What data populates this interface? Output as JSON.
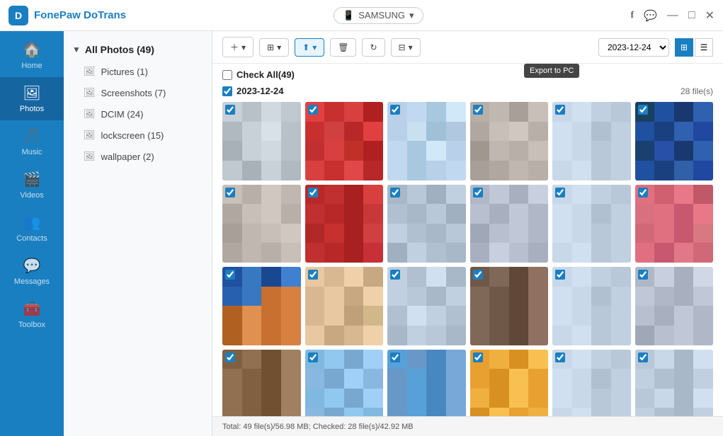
{
  "app": {
    "name": "FonePaw DoTrans",
    "logo_letter": "D"
  },
  "title_bar": {
    "device_name": "SAMSUNG",
    "device_icon": "📱",
    "dropdown_arrow": "▾",
    "fb_icon": "f",
    "chat_icon": "💬",
    "minimize": "—",
    "maximize": "□",
    "close": "✕"
  },
  "nav": {
    "items": [
      {
        "id": "home",
        "label": "Home",
        "icon": "🏠",
        "active": false
      },
      {
        "id": "photos",
        "label": "Photos",
        "icon": "👤",
        "active": true
      },
      {
        "id": "music",
        "label": "Music",
        "icon": "🎵",
        "active": false
      },
      {
        "id": "videos",
        "label": "Videos",
        "icon": "🎬",
        "active": false
      },
      {
        "id": "contacts",
        "label": "Contacts",
        "icon": "👥",
        "active": false
      },
      {
        "id": "messages",
        "label": "Messages",
        "icon": "💬",
        "active": false
      },
      {
        "id": "toolbox",
        "label": "Toolbox",
        "icon": "🧰",
        "active": false
      }
    ]
  },
  "tree": {
    "root_label": "All Photos (49)",
    "items": [
      {
        "label": "Pictures (1)",
        "count": 1
      },
      {
        "label": "Screenshots (7)",
        "count": 7
      },
      {
        "label": "DCIM (24)",
        "count": 24
      },
      {
        "label": "lockscreen (15)",
        "count": 15
      },
      {
        "label": "wallpaper (2)",
        "count": 2
      }
    ]
  },
  "toolbar": {
    "add_label": "+",
    "copy_label": "⊞",
    "export_label": "⬆",
    "export_tooltip": "Export to PC",
    "delete_label": "🗑",
    "refresh_label": "↻",
    "more_label": "⊟",
    "date_value": "2023-12-24",
    "grid_view_label": "⊞",
    "list_view_label": "☰"
  },
  "content": {
    "check_all_label": "Check All(49)",
    "date_section": "2023-12-24",
    "file_count": "28 file(s)",
    "rows": [
      {
        "photos": [
          {
            "colors": [
              "#c8d0d8",
              "#b8c0c8",
              "#d0d8e0",
              "#c0c8d0",
              "#b0b8c0",
              "#c8d0d8",
              "#d8e0e8",
              "#b8c0c8",
              "#a8b0b8",
              "#c8d0d8",
              "#d0d8e0",
              "#b8c0c8",
              "#c0c8d0",
              "#a8b0b8",
              "#c8d0d8",
              "#b0b8c0"
            ]
          },
          {
            "colors": [
              "#e04040",
              "#c83030",
              "#d84040",
              "#b02020",
              "#c83030",
              "#d04040",
              "#b82828",
              "#e04040",
              "#c03030",
              "#d84040",
              "#c03028",
              "#b02020",
              "#d84040",
              "#c83030",
              "#e04848",
              "#b82828"
            ]
          },
          {
            "colors": [
              "#b8d0e8",
              "#c0d8f0",
              "#a8c8e0",
              "#d0e8f8",
              "#b8d0e8",
              "#c8e0f0",
              "#a0c0d8",
              "#b0c8e0",
              "#c0d8f0",
              "#a8c8e0",
              "#d0e8f8",
              "#b8d0e8",
              "#c0d8f0",
              "#a8c8e0",
              "#b8d0e8",
              "#c0d8f0"
            ]
          },
          {
            "colors": [
              "#b8b0a8",
              "#c0b8b0",
              "#a8a098",
              "#c8c0b8",
              "#b0a8a0",
              "#c8c0b8",
              "#d0c8c0",
              "#b8b0a8",
              "#a0988e",
              "#c0b8b0",
              "#b8b0a8",
              "#c8c0b8",
              "#a8a098",
              "#b0a8a0",
              "#c0b8b0",
              "#b8b0a8"
            ]
          },
          {
            "colors": [
              "#c8d8e8",
              "#d0e0f0",
              "#c0d0e0",
              "#b8c8d8",
              "#d0e0f0",
              "#c8d8e8",
              "#b0c0d0",
              "#c0d0e0",
              "#d0e0f0",
              "#c8d8e8",
              "#b8c8d8",
              "#c0d0e0",
              "#c8d8e8",
              "#d0e0f0",
              "#b8c8d8",
              "#c0d0e0"
            ]
          },
          {
            "colors": [
              "#1a4060",
              "#2050a0",
              "#1a3870",
              "#3060b0",
              "#2050a0",
              "#1a4080",
              "#3060b0",
              "#2048a0",
              "#1a4070",
              "#2850a8",
              "#1a3870",
              "#3060b0",
              "#2050a0",
              "#1a4080",
              "#3060a8",
              "#2048a0"
            ]
          }
        ]
      },
      {
        "photos": [
          {
            "colors": [
              "#c8c0b8",
              "#b8b0a8",
              "#d0c8c0",
              "#c0b8b0",
              "#b0a8a0",
              "#c8c0b8",
              "#d0c8c0",
              "#b8b0a8",
              "#a8a098",
              "#c0b8b0",
              "#c8c0b8",
              "#d0c8c0",
              "#b0a8a0",
              "#c0b8b0",
              "#b8b0a8",
              "#c8c0b8"
            ]
          },
          {
            "colors": [
              "#b82828",
              "#c03030",
              "#a82020",
              "#d84040",
              "#c03030",
              "#b82828",
              "#a82020",
              "#c83838",
              "#b02828",
              "#c83030",
              "#a82020",
              "#d04040",
              "#c03030",
              "#b82828",
              "#a82020",
              "#c83038"
            ]
          },
          {
            "colors": [
              "#a8b8c8",
              "#b8c8d8",
              "#a0b0c0",
              "#c0d0e0",
              "#b0c0d0",
              "#a8b8c8",
              "#b8c8d8",
              "#a0b0c0",
              "#c0d0e0",
              "#b0c0d0",
              "#a8b8c8",
              "#b8c8d8",
              "#a0b0c0",
              "#c0d0e0",
              "#b0c0d0",
              "#a8b8c8"
            ]
          },
          {
            "colors": [
              "#b0b8c8",
              "#c0c8d8",
              "#a8b0c0",
              "#c8d0e0",
              "#b8c0d0",
              "#a8b0c0",
              "#c0c8d8",
              "#b0b8c8",
              "#a0a8b8",
              "#b8c0d0",
              "#c0c8d8",
              "#b0b8c8",
              "#a8b0c0",
              "#c8d0e0",
              "#b8c0d0",
              "#a8b0c0"
            ]
          },
          {
            "colors": [
              "#c8d8e8",
              "#d0e0f0",
              "#c0d0e0",
              "#b8c8d8",
              "#d0e0f0",
              "#c8d8e8",
              "#b0c0d0",
              "#c0d0e0",
              "#d0e0f0",
              "#c8d8e8",
              "#b8c8d8",
              "#c0d0e0",
              "#c8d8e8",
              "#d0e0f0",
              "#b8c8d8",
              "#c0d0e0"
            ]
          },
          {
            "colors": [
              "#e07080",
              "#d06070",
              "#e87888",
              "#c05868",
              "#d87080",
              "#e07080",
              "#c85870",
              "#e87888",
              "#d06878",
              "#e07080",
              "#c85870",
              "#d87880",
              "#e07080",
              "#c85870",
              "#e07888",
              "#d06878"
            ]
          }
        ]
      },
      {
        "photos": [
          {
            "colors": [
              "#2050a0",
              "#3878c0",
              "#1a4890",
              "#4080d0",
              "#2860b0",
              "#3878c0",
              "#c87030",
              "#d88040",
              "#b06020",
              "#e09050",
              "#c87030",
              "#d88040",
              "#b06020",
              "#e09050",
              "#c87030",
              "#d88040"
            ]
          },
          {
            "colors": [
              "#e8c8a0",
              "#d8b890",
              "#f0d0a8",
              "#c8a880",
              "#d8b890",
              "#e8c8a0",
              "#c8a880",
              "#f0d0a8",
              "#d8b890",
              "#e8c8a0",
              "#c0a078",
              "#d0b888",
              "#e8c8a0",
              "#c8a880",
              "#d8b890",
              "#f0d0a8"
            ]
          },
          {
            "colors": [
              "#c0d0e0",
              "#b0c0d0",
              "#d0e0f0",
              "#a8b8c8",
              "#c0d0e0",
              "#b8c8d8",
              "#a8b8c8",
              "#c0d0e0",
              "#b0c0d0",
              "#d0e0f0",
              "#c0d0e0",
              "#b0c0d0",
              "#a8b8c8",
              "#c0d0e0",
              "#b8c8d8",
              "#a8b8c8"
            ]
          },
          {
            "colors": [
              "#705848",
              "#806858",
              "#604838",
              "#907060",
              "#806858",
              "#705848",
              "#604838",
              "#907060",
              "#806858",
              "#705848",
              "#604838",
              "#907060",
              "#806858",
              "#705848",
              "#604838",
              "#907060"
            ]
          },
          {
            "colors": [
              "#c8d8e8",
              "#d0e0f0",
              "#c0d0e0",
              "#b8c8d8",
              "#d0e0f0",
              "#c8d8e8",
              "#b0c0d0",
              "#c0d0e0",
              "#d0e0f0",
              "#c8d8e8",
              "#b8c8d8",
              "#c0d0e0",
              "#c8d8e8",
              "#d0e0f0",
              "#b8c8d8",
              "#c0d0e0"
            ]
          },
          {
            "colors": [
              "#b0b8c8",
              "#c8d0e0",
              "#a8b0c0",
              "#d0d8e8",
              "#c0c8d8",
              "#b0b8c8",
              "#a8b0c0",
              "#c0c8d8",
              "#b8c0d0",
              "#a8b0c0",
              "#c0c8d8",
              "#b0b8c8",
              "#a0a8b8",
              "#b8c0d0",
              "#c0c8d8",
              "#b0b8c8"
            ]
          }
        ]
      },
      {
        "photos": [
          {
            "colors": [
              "#806040",
              "#907050",
              "#705030",
              "#a08060",
              "#907050",
              "#806040",
              "#705030",
              "#a08060",
              "#907050",
              "#806040",
              "#705030",
              "#a08060",
              "#907050",
              "#806040",
              "#705030",
              "#a08060"
            ]
          },
          {
            "colors": [
              "#80b8e0",
              "#90c8f0",
              "#78a8d0",
              "#a0d0f8",
              "#88b8e0",
              "#78a8d0",
              "#a0d0f8",
              "#88b8e0",
              "#80b8e0",
              "#90c8f0",
              "#78a8d0",
              "#a0d0f8",
              "#88b8e0",
              "#78a8d0",
              "#90c8f0",
              "#80b8e0"
            ]
          },
          {
            "colors": [
              "#58a0d8",
              "#6898c8",
              "#4888c0",
              "#78a8d8",
              "#6898c8",
              "#58a0d8",
              "#4888c0",
              "#78a8d8",
              "#6898c8",
              "#58a0d8",
              "#4888c0",
              "#78a8d8",
              "#6898c8",
              "#58a0d8",
              "#4888c0",
              "#78a8d8"
            ]
          },
          {
            "colors": [
              "#e8a030",
              "#f0b040",
              "#d89020",
              "#f8c050",
              "#e8a030",
              "#d89020",
              "#f8c050",
              "#e8a030",
              "#f0b040",
              "#d89020",
              "#f8c050",
              "#e8a030",
              "#d89020",
              "#f8c050",
              "#e8a030",
              "#f0b040"
            ]
          },
          {
            "colors": [
              "#c8d8e8",
              "#d0e0f0",
              "#c0d0e0",
              "#b8c8d8",
              "#d0e0f0",
              "#c8d8e8",
              "#b0c0d0",
              "#c0d0e0",
              "#d0e0f0",
              "#c8d8e8",
              "#b8c8d8",
              "#c0d0e0",
              "#c8d8e8",
              "#d0e0f0",
              "#b8c8d8",
              "#c0d0e0"
            ]
          },
          {
            "colors": [
              "#b8c8d8",
              "#c8d8e8",
              "#a8b8c8",
              "#d0e0f0",
              "#c0d0e0",
              "#b0c0d0",
              "#a8b8c8",
              "#c0d0e0",
              "#b8c8d8",
              "#c8d8e8",
              "#a8b8c8",
              "#d0e0f0",
              "#c0d0e0",
              "#b0c0d0",
              "#a8b8c8",
              "#c0d0e0"
            ]
          }
        ]
      }
    ]
  },
  "status_bar": {
    "text": "Total: 49 file(s)/56.98 MB; Checked: 28 file(s)/42.92 MB"
  }
}
